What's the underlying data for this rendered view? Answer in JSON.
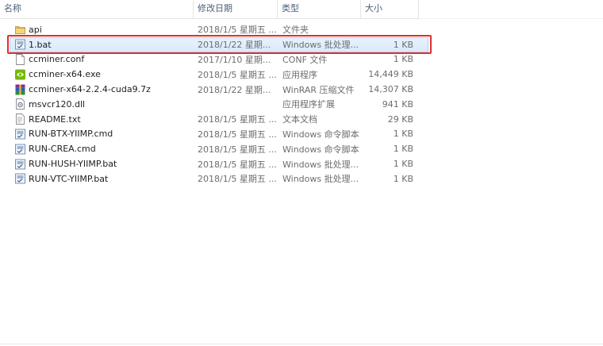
{
  "columns": {
    "name": "名称",
    "date": "修改日期",
    "type": "类型",
    "size": "大小"
  },
  "sort_indicator": "^",
  "files": [
    {
      "name": "api",
      "date": "2018/1/5 星期五 ...",
      "type": "文件夹",
      "size": "",
      "icon": "folder-icon"
    },
    {
      "name": "1.bat",
      "date": "2018/1/22 星期...",
      "type": "Windows 批处理...",
      "size": "1 KB",
      "icon": "batch-file-icon",
      "selected": true
    },
    {
      "name": "ccminer.conf",
      "date": "2017/1/10 星期...",
      "type": "CONF 文件",
      "size": "1 KB",
      "icon": "blank-file-icon"
    },
    {
      "name": "ccminer-x64.exe",
      "date": "2018/1/5 星期五 ...",
      "type": "应用程序",
      "size": "14,449 KB",
      "icon": "nvidia-app-icon"
    },
    {
      "name": "ccminer-x64-2.2.4-cuda9.7z",
      "date": "2018/1/22 星期...",
      "type": "WinRAR 压缩文件",
      "size": "14,307 KB",
      "icon": "winrar-archive-icon"
    },
    {
      "name": "msvcr120.dll",
      "date": "",
      "type": "应用程序扩展",
      "size": "941 KB",
      "icon": "dll-file-icon"
    },
    {
      "name": "README.txt",
      "date": "2018/1/5 星期五 ...",
      "type": "文本文档",
      "size": "29 KB",
      "icon": "text-file-icon"
    },
    {
      "name": "RUN-BTX-YIIMP.cmd",
      "date": "2018/1/5 星期五 ...",
      "type": "Windows 命令脚本",
      "size": "1 KB",
      "icon": "cmd-script-icon"
    },
    {
      "name": "RUN-CREA.cmd",
      "date": "2018/1/5 星期五 ...",
      "type": "Windows 命令脚本",
      "size": "1 KB",
      "icon": "cmd-script-icon"
    },
    {
      "name": "RUN-HUSH-YIIMP.bat",
      "date": "2018/1/5 星期五 ...",
      "type": "Windows 批处理...",
      "size": "1 KB",
      "icon": "batch-file-icon"
    },
    {
      "name": "RUN-VTC-YIIMP.bat",
      "date": "2018/1/5 星期五 ...",
      "type": "Windows 批处理...",
      "size": "1 KB",
      "icon": "batch-file-icon"
    }
  ],
  "colors": {
    "highlight_border": "#e0302b",
    "selection_bg": "#d9eafc",
    "header_text": "#4c607a",
    "meta_text": "#6d6d6d"
  }
}
